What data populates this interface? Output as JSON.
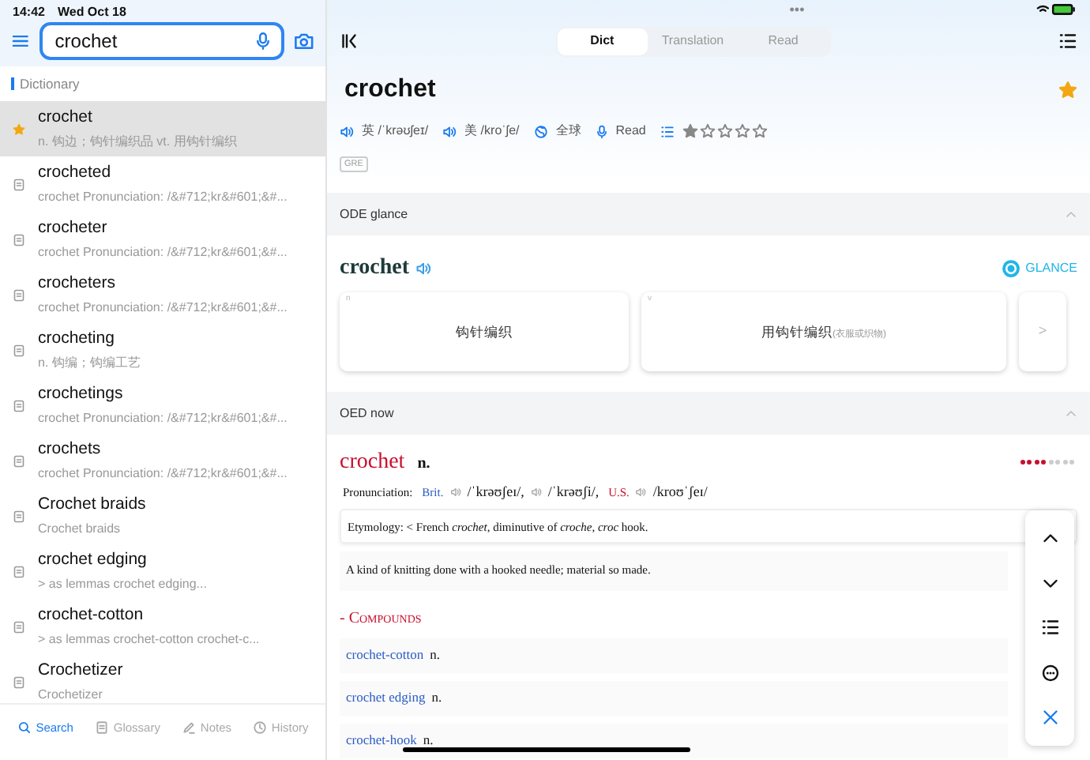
{
  "status_bar": {
    "time": "14:42",
    "date": "Wed Oct 18",
    "more": "•••"
  },
  "search": {
    "value": "crochet"
  },
  "sidebar": {
    "section": "Dictionary",
    "items": [
      {
        "word": "crochet",
        "summary": "n. 钩边；钩针编织品 vt. 用钩针编织",
        "favorite": true,
        "selected": true
      },
      {
        "word": "crocheted",
        "summary": "crochet  Pronunciation: /&#712;kr&#601;&#...",
        "favorite": false,
        "selected": false
      },
      {
        "word": "crocheter",
        "summary": "crochet  Pronunciation: /&#712;kr&#601;&#...",
        "favorite": false,
        "selected": false
      },
      {
        "word": "crocheters",
        "summary": "crochet  Pronunciation: /&#712;kr&#601;&#...",
        "favorite": false,
        "selected": false
      },
      {
        "word": "crocheting",
        "summary": "n. 钩编；钩编工艺",
        "favorite": false,
        "selected": false
      },
      {
        "word": "crochetings",
        "summary": "crochet  Pronunciation: /&#712;kr&#601;&#...",
        "favorite": false,
        "selected": false
      },
      {
        "word": "crochets",
        "summary": "crochet  Pronunciation: /&#712;kr&#601;&#...",
        "favorite": false,
        "selected": false
      },
      {
        "word": "Crochet braids",
        "summary": "Crochet braids",
        "favorite": false,
        "selected": false
      },
      {
        "word": "crochet edging",
        "summary": "> as lemmas  crochet edging...",
        "favorite": false,
        "selected": false
      },
      {
        "word": "crochet-cotton",
        "summary": "> as lemmas  crochet-cotton      crochet-c...",
        "favorite": false,
        "selected": false
      },
      {
        "word": "Crochetizer",
        "summary": "Crochetizer",
        "favorite": false,
        "selected": false
      }
    ]
  },
  "bottom_tabs": [
    {
      "label": "Search",
      "kind": "search",
      "selected": true
    },
    {
      "label": "Glossary",
      "kind": "glossary",
      "selected": false
    },
    {
      "label": "Notes",
      "kind": "notes",
      "selected": false
    },
    {
      "label": "History",
      "kind": "history",
      "selected": false
    }
  ],
  "tabs": [
    {
      "label": "Dict",
      "selected": true
    },
    {
      "label": "Translation",
      "selected": false
    },
    {
      "label": "Read",
      "selected": false
    }
  ],
  "entry": {
    "headword": "crochet",
    "favorite": true,
    "uk": {
      "label": "英",
      "ipa": "/ˈkrəʊʃeɪ/"
    },
    "us": {
      "label": "美",
      "ipa": "/kroˈʃe/"
    },
    "global": "全球",
    "read": "Read",
    "stars": 1,
    "tag": "GRE"
  },
  "ode": {
    "title": "ODE glance",
    "expanded": true,
    "headword": "crochet",
    "brand": "GLANCE",
    "cards": [
      {
        "pos": "n",
        "meaning": "钩针编织"
      },
      {
        "pos": "v",
        "meaning": "用钩针编织",
        "note": "(衣服或织物)"
      }
    ],
    "more": ">"
  },
  "oed": {
    "title": "OED now",
    "expanded": true,
    "headword": "crochet",
    "pos": "n.",
    "frequency": {
      "stars": 4
    },
    "pronunciation": {
      "label": "Pronunciation:",
      "groups": [
        {
          "region": "Brit.",
          "color": "#2a5cc7",
          "forms": [
            "/ˈkrəʊʃeɪ/,",
            "/ˈkrəʊʃi/,"
          ]
        },
        {
          "region": "U.S.",
          "color": "#c8102e",
          "forms": [
            "/kroʊˈʃeɪ/"
          ]
        }
      ]
    },
    "etymology": "Etymology: < French *crochet*, diminutive of *croche*, *croc* hook.",
    "definition": "A kind of knitting done with a hooked needle; material so made.",
    "section": "- Compounds",
    "compounds": [
      {
        "word": "crochet-cotton",
        "pos": "n."
      },
      {
        "word": "crochet edging",
        "pos": "n."
      },
      {
        "word": "crochet-hook",
        "pos": "n."
      }
    ]
  }
}
